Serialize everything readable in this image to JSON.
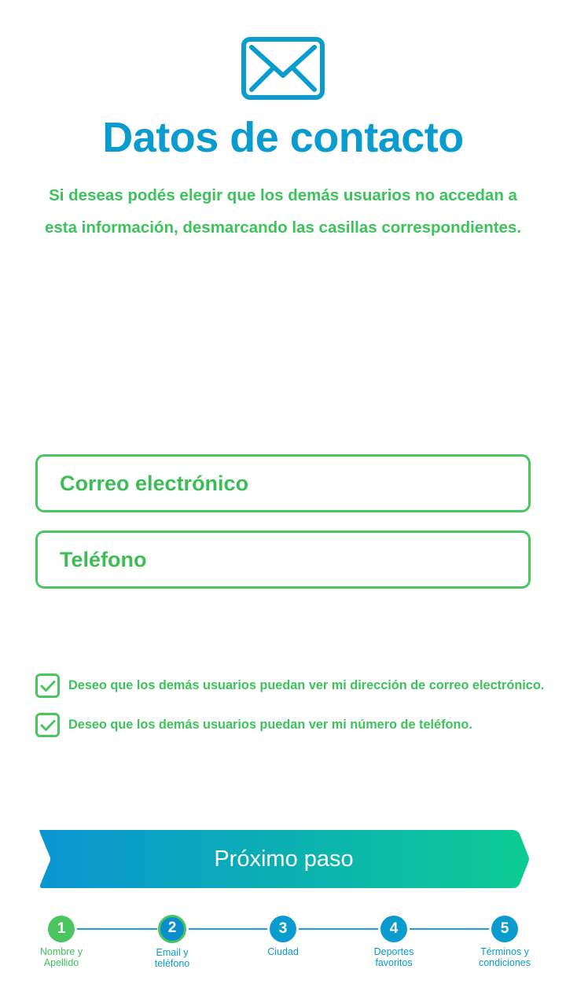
{
  "header": {
    "icon": "envelope-icon",
    "title": "Datos de contacto",
    "subtitle": "Si deseas podés elegir que los demás usuarios no accedan a esta información, desmarcando las casillas correspondientes."
  },
  "form": {
    "email": {
      "placeholder": "Correo electrónico",
      "value": ""
    },
    "phone": {
      "placeholder": "Teléfono",
      "value": ""
    }
  },
  "checkboxes": [
    {
      "label": "Deseo que los demás usuarios puedan ver mi dirección de correo electrónico.",
      "checked": true
    },
    {
      "label": "Deseo que los demás usuarios puedan ver mi número de teléfono.",
      "checked": true
    }
  ],
  "next_button": {
    "label": "Próximo paso"
  },
  "stepper": {
    "current": 2,
    "steps": [
      {
        "number": "1",
        "label_line1": "Nombre y",
        "label_line2": "Apellido"
      },
      {
        "number": "2",
        "label_line1": "Email y",
        "label_line2": "teléfono"
      },
      {
        "number": "3",
        "label_line1": "Ciudad",
        "label_line2": ""
      },
      {
        "number": "4",
        "label_line1": "Deportes",
        "label_line2": "favoritos"
      },
      {
        "number": "5",
        "label_line1": "Términos y",
        "label_line2": "condiciones"
      }
    ]
  },
  "colors": {
    "blue": "#0a9bcf",
    "green": "#4bc55f",
    "gradient_start": "#0a95d2",
    "gradient_end": "#0ccb93"
  }
}
